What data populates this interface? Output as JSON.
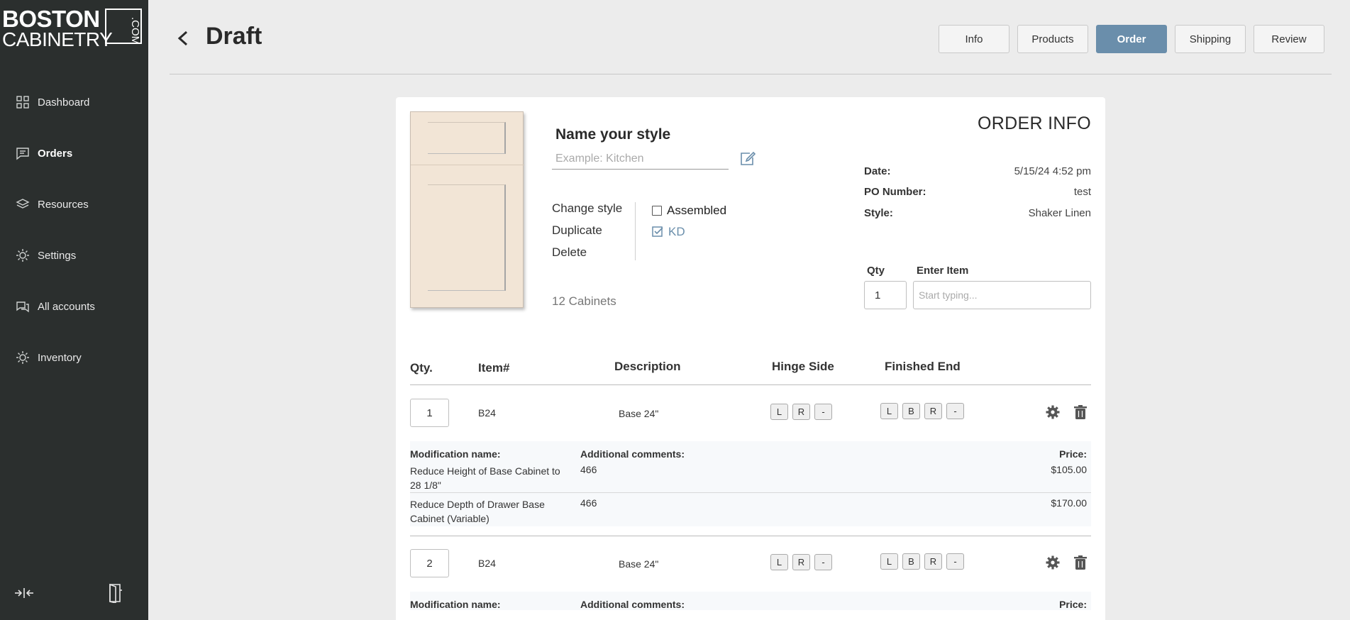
{
  "sidebar": {
    "logo": {
      "line1": "BOSTON",
      "line2": "CABINETRY",
      "suffix": ".COM"
    },
    "items": [
      {
        "label": "Dashboard",
        "icon": "grid-icon",
        "active": false
      },
      {
        "label": "Orders",
        "icon": "orders-icon",
        "active": true
      },
      {
        "label": "Resources",
        "icon": "layers-icon",
        "active": false
      },
      {
        "label": "Settings",
        "icon": "settings-icon",
        "active": false
      },
      {
        "label": "All accounts",
        "icon": "accounts-icon",
        "active": false
      },
      {
        "label": "Inventory",
        "icon": "inventory-icon",
        "active": false
      }
    ]
  },
  "header": {
    "title": "Draft",
    "tabs": [
      {
        "label": "Info"
      },
      {
        "label": "Products"
      },
      {
        "label": "Order",
        "active": true
      },
      {
        "label": "Shipping"
      },
      {
        "label": "Review"
      }
    ]
  },
  "style": {
    "heading": "Name your style",
    "placeholder": "Example: Kitchen",
    "actions": [
      "Change style",
      "Duplicate",
      "Delete"
    ],
    "assembled_label": "Assembled",
    "kd_label": "KD",
    "count": "12 Cabinets"
  },
  "order_info": {
    "title": "ORDER INFO",
    "date_label": "Date:",
    "date": "5/15/24 4:52 pm",
    "po_label": "PO Number:",
    "po": "test",
    "style_label": "Style:",
    "style": "Shaker Linen",
    "qty_label": "Qty",
    "qty_value": "1",
    "item_label": "Enter Item",
    "item_placeholder": "Start typing..."
  },
  "table": {
    "headers": {
      "qty": "Qty.",
      "item": "Item#",
      "desc": "Description",
      "hinge": "Hinge Side",
      "finished": "Finished End"
    },
    "hinge_options": [
      "L",
      "R",
      "-"
    ],
    "finished_options": [
      "L",
      "B",
      "R",
      "-"
    ],
    "mods_headers": {
      "name": "Modification name:",
      "comments": "Additional comments:",
      "price": "Price:"
    },
    "rows": [
      {
        "qty": "1",
        "item": "B24",
        "desc": "Base 24\"",
        "mods": [
          {
            "name": "Reduce Height of Base Cabinet to 28 1/8\"",
            "comment": "466",
            "price": "$105.00"
          },
          {
            "name": "Reduce Depth of Drawer Base Cabinet (Variable)",
            "comment": "466",
            "price": "$170.00"
          }
        ]
      },
      {
        "qty": "2",
        "item": "B24",
        "desc": "Base 24\""
      }
    ]
  }
}
